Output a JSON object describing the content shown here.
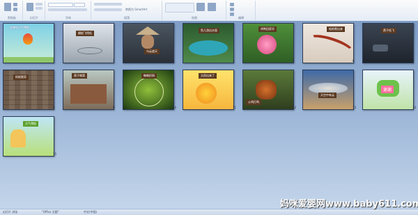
{
  "ribbon": {
    "groups": [
      "剪贴板",
      "幻灯片",
      "字体",
      "段落",
      "绘图",
      "编辑"
    ],
    "convert_label": "转换为 SmartArt"
  },
  "slides": [
    {
      "number": "1",
      "title": "动物和天气预报"
    },
    {
      "number": "2",
      "title": "蜻蜓飞得低"
    },
    {
      "number": "3",
      "title": "乌云遮天"
    },
    {
      "number": "4",
      "title": "鱼儿游出水面"
    },
    {
      "number": "5",
      "title": "鸡鸭回家早"
    },
    {
      "number": "6",
      "title": "蚯蚓爬出来"
    },
    {
      "number": "7",
      "title": "燕子低飞"
    },
    {
      "number": "8",
      "title": "蚂蚁搬家"
    },
    {
      "number": "9",
      "title": "燕子做窝"
    },
    {
      "number": "10",
      "title": "蜘蛛织网"
    },
    {
      "number": "11",
      "title": "太阳出来了"
    },
    {
      "number": "12",
      "title": "公鸡打鸣"
    },
    {
      "number": "13",
      "title": "天空中有云"
    },
    {
      "number": "14",
      "title": "谢谢"
    },
    {
      "number": "15",
      "title": "天气预报"
    }
  ],
  "status": {
    "slide_info": "幻灯片 浏览",
    "theme": "\"Office 主题\"",
    "lang": "中文(中国)"
  },
  "watermark": "妈咪爱婴网www.baby611.com"
}
